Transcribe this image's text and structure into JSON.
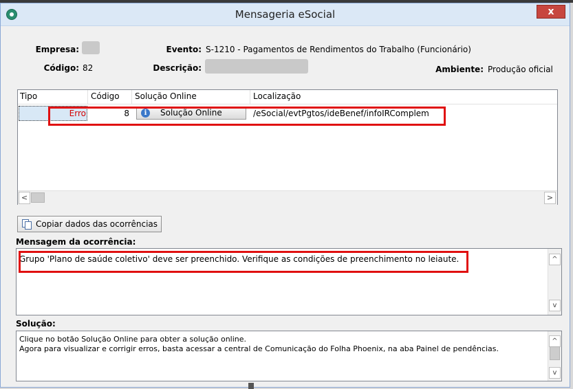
{
  "window": {
    "title": "Mensageria eSocial",
    "close_glyph": "x",
    "app_icon": "esocial-app-icon"
  },
  "info": {
    "empresa_label": "Empresa:",
    "empresa_value": "",
    "codigo_label": "Código:",
    "codigo_value": "82",
    "evento_label": "Evento:",
    "evento_value": "S-1210 - Pagamentos de Rendimentos do Trabalho (Funcionário)",
    "descricao_label": "Descrição:",
    "descricao_value": "",
    "ambiente_label": "Ambiente:",
    "ambiente_value": "Produção oficial"
  },
  "grid": {
    "columns": [
      "Tipo",
      "Código",
      "Solução Online",
      "Localização"
    ],
    "rows": [
      {
        "tipo": "Erro",
        "codigo": "8",
        "solucao_button": "Solução Online",
        "localizacao": "/eSocial/evtPgtos/ideBenef/infoIRComplem"
      }
    ]
  },
  "copy_button": {
    "label": "Copiar dados das ocorrências",
    "icon": "copy-icon"
  },
  "mensagem": {
    "label": "Mensagem da ocorrência:",
    "text": "Grupo 'Plano de saúde coletivo' deve ser preenchido. Verifique as condições de preenchimento no leiaute."
  },
  "solucao": {
    "label": "Solução:",
    "line1": "Clique no botão Solução Online para obter a solução online.",
    "line2": "Agora para visualizar e corrigir erros, basta acessar a central de Comunicação do Folha Phoenix, na aba Painel de pendências."
  },
  "scroll_glyphs": {
    "left": "<",
    "right": ">",
    "up": "^",
    "down": "v"
  },
  "colors": {
    "highlight": "#e01010",
    "error_text": "#d40000",
    "titlebar": "#dbe8f6"
  }
}
